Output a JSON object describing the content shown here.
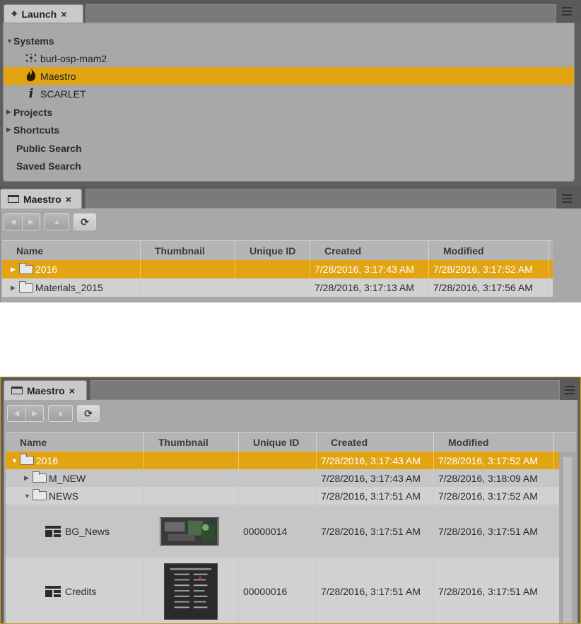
{
  "launch": {
    "tab_label": "Launch",
    "close_glyph": "×",
    "items": [
      {
        "label": "Systems",
        "expanded": true
      },
      {
        "label": "burl-osp-mam2",
        "icon": "network-node-icon"
      },
      {
        "label": "Maestro",
        "icon": "flame-icon",
        "selected": true
      },
      {
        "label": "SCARLET",
        "icon": "interplay-i-icon"
      },
      {
        "label": "Projects",
        "expanded": false
      },
      {
        "label": "Shortcuts",
        "expanded": false
      },
      {
        "label": "Public Search"
      },
      {
        "label": "Saved Search"
      }
    ]
  },
  "maestro_top": {
    "tab_label": "Maestro",
    "close_glyph": "×",
    "columns": [
      "Name",
      "Thumbnail",
      "Unique ID",
      "Created",
      "Modified"
    ],
    "rows": [
      {
        "name": "2016",
        "created": "7/28/2016, 3:17:43 AM",
        "modified": "7/28/2016, 3:17:52 AM",
        "selected": true
      },
      {
        "name": "Materials_2015",
        "created": "7/28/2016, 3:17:13 AM",
        "modified": "7/28/2016, 3:17:56 AM"
      }
    ]
  },
  "maestro_bottom": {
    "tab_label": "Maestro",
    "close_glyph": "×",
    "columns": [
      "Name",
      "Thumbnail",
      "Unique ID",
      "Created",
      "Modified"
    ],
    "rows": [
      {
        "name": "2016",
        "created": "7/28/2016, 3:17:43 AM",
        "modified": "7/28/2016, 3:17:52 AM",
        "selected": true,
        "expanded": true
      },
      {
        "name": "M_NEW",
        "created": "7/28/2016, 3:17:43 AM",
        "modified": "7/28/2016, 3:18:09 AM"
      },
      {
        "name": "NEWS",
        "created": "7/28/2016, 3:17:51 AM",
        "modified": "7/28/2016, 3:17:52 AM",
        "expanded": true
      },
      {
        "name": "BG_News",
        "unique_id": "00000014",
        "created": "7/28/2016, 3:17:51 AM",
        "modified": "7/28/2016, 3:17:51 AM"
      },
      {
        "name": "Credits",
        "unique_id": "00000016",
        "created": "7/28/2016, 3:17:51 AM",
        "modified": "7/28/2016, 3:17:51 AM"
      }
    ]
  },
  "colors": {
    "selection": "#e3a413",
    "panel_bg": "#a8a8a8",
    "frame": "#5f5f5f"
  }
}
